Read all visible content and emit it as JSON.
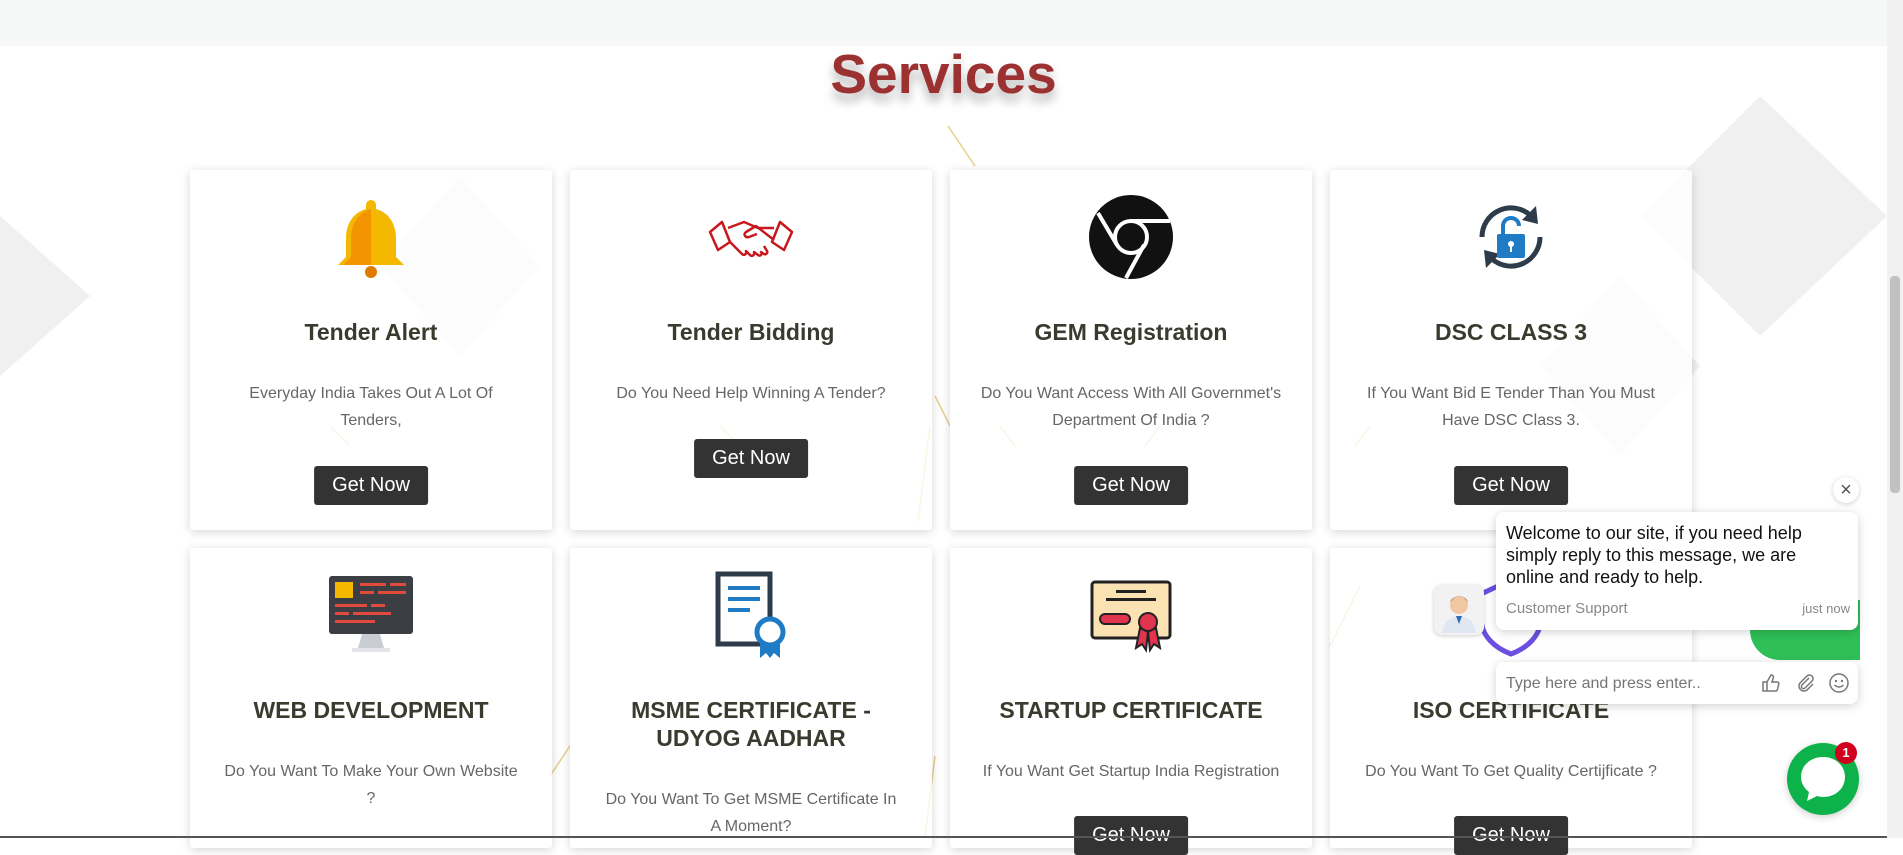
{
  "page": {
    "title": "Services"
  },
  "cards": [
    {
      "title": "Tender Alert",
      "desc": "Everyday India Takes Out A Lot Of Tenders,",
      "button": "Get Now",
      "icon": "bell-icon"
    },
    {
      "title": "Tender Bidding",
      "desc": "Do You Need Help Winning A Tender?",
      "button": "Get Now",
      "icon": "handshake-icon"
    },
    {
      "title": "GEM Registration",
      "desc": "Do You Want Access With All Governmet's Department Of India ?",
      "button": "Get Now",
      "icon": "chrome-icon"
    },
    {
      "title": "DSC CLASS 3",
      "desc": "If You Want Bid E Tender Than You Must Have DSC Class 3.",
      "button": "Get Now",
      "icon": "lock-refresh-icon"
    },
    {
      "title": "WEB DEVELOPMENT",
      "desc": "Do You Want To Make Your Own Website ?",
      "button": "Get Now",
      "icon": "monitor-icon"
    },
    {
      "title": "MSME CERTIFICATE - UDYOG AADHAR",
      "desc": "Do You Want To Get MSME Certificate In A Moment?",
      "button": "Get Now",
      "icon": "certificate-document-icon"
    },
    {
      "title": "STARTUP CERTIFICATE",
      "desc": "If You Want Get Startup India Registration",
      "button": "Get Now",
      "icon": "certificate-icon"
    },
    {
      "title": "ISO CERTIFICATE",
      "desc": "Do You Want To Get Quality Certijficate ?",
      "button": "Get Now",
      "icon": "iso-icon"
    }
  ],
  "chat": {
    "message": "Welcome to our site, if you need help simply reply to this message, we are online and ready to help.",
    "agent": "Customer Support",
    "time": "just now",
    "input_placeholder": "Type here and press enter..",
    "badge_count": "1"
  },
  "colors": {
    "title": "#9b3131",
    "button": "#333333",
    "chat_green": "#0db24b",
    "badge": "#d0001f"
  }
}
